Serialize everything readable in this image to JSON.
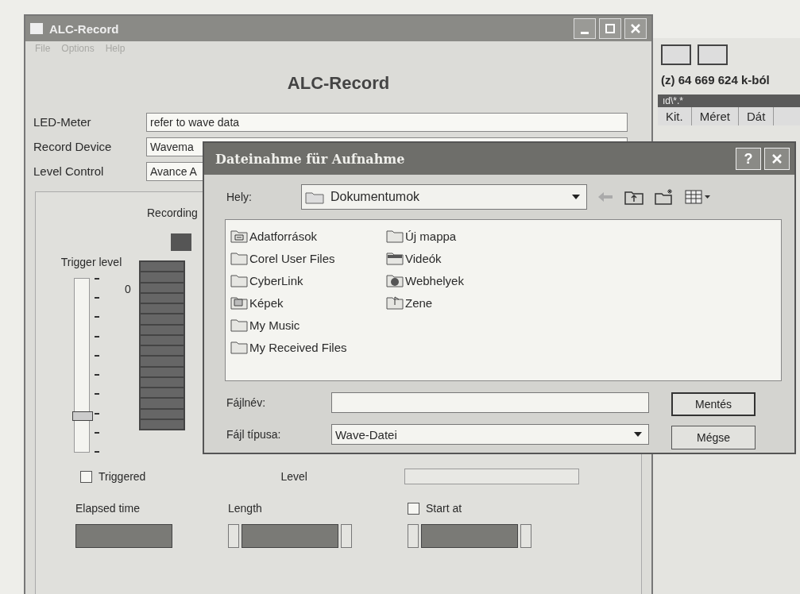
{
  "background_window": {
    "free_space": "(z) 64 669 624 k-ból",
    "path": "ıd\\*.*",
    "columns": [
      "Kit.",
      "Méret",
      "Dát"
    ]
  },
  "app": {
    "title": "ALC-Record",
    "menu": [
      {
        "label": "File",
        "disabled": true
      },
      {
        "label": "Options",
        "disabled": true
      },
      {
        "label": "Help",
        "disabled": true
      }
    ],
    "heading": "ALC-Record",
    "fields": [
      {
        "label": "LED-Meter",
        "value": "refer to wave data"
      },
      {
        "label": "Record Device",
        "value": "Wavema"
      },
      {
        "label": "Level Control",
        "value": "Avance A"
      }
    ],
    "panel": {
      "recording_label": "Recording",
      "recording": true,
      "trigger_label": "Trigger level",
      "trigger": {
        "level": 0.18
      },
      "meter_label": "0",
      "triggered": {
        "label": "Triggered",
        "checked": false
      },
      "level_label": "Level",
      "elapsed_label": "Elapsed time",
      "length_label": "Length",
      "start_at": {
        "label": "Start at",
        "checked": false
      }
    }
  },
  "dialog": {
    "title": "Dateinahme für Aufnahme",
    "help_glyph": "?",
    "location_label": "Hely:",
    "location": "Dokumentumok",
    "files": [
      {
        "name": "Adatforrások",
        "kind": "shared"
      },
      {
        "name": "Corel User Files",
        "kind": "folder"
      },
      {
        "name": "CyberLink",
        "kind": "folder"
      },
      {
        "name": "Képek",
        "kind": "pictures"
      },
      {
        "name": "My Music",
        "kind": "folder"
      },
      {
        "name": "My Received Files",
        "kind": "folder"
      },
      {
        "name": "Új mappa",
        "kind": "folder"
      },
      {
        "name": "Videók",
        "kind": "video"
      },
      {
        "name": "Webhelyek",
        "kind": "web"
      },
      {
        "name": "Zene",
        "kind": "music"
      }
    ],
    "filename_label": "Fájlnév:",
    "filetype_label": "Fájl típusa:",
    "filetype": "Wave-Datei",
    "buttons": [
      "Mentés",
      "Mégse"
    ]
  }
}
